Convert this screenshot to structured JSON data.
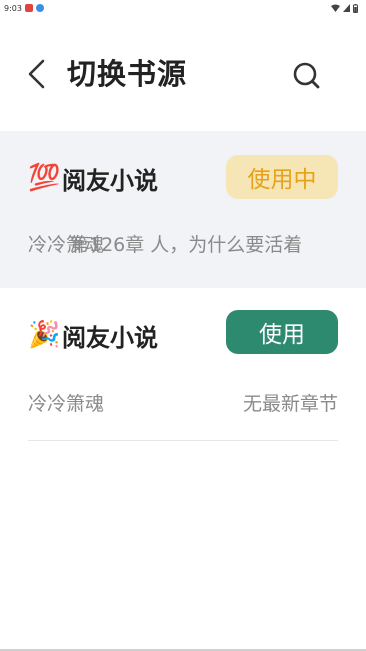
{
  "status_bar": {
    "time": "9:03"
  },
  "header": {
    "title": "切换书源",
    "back_icon": "chevron-left-icon",
    "search_icon": "search-icon"
  },
  "sources": [
    {
      "emoji": "💯",
      "name": "阅友小说",
      "button_label": "使用中",
      "author": "冷冷箫魂",
      "latest_chapter": "第126章 人，为什么要活着"
    },
    {
      "emoji": "🎉",
      "name": "阅友小说",
      "button_label": "使用",
      "author": "冷冷箫魂",
      "latest_chapter": "无最新章节"
    }
  ],
  "colors": {
    "in_use_bg": "#f6e6b6",
    "in_use_text": "#e6a21a",
    "use_bg": "#2e8a6e",
    "active_card_bg": "#f1f3f6"
  }
}
